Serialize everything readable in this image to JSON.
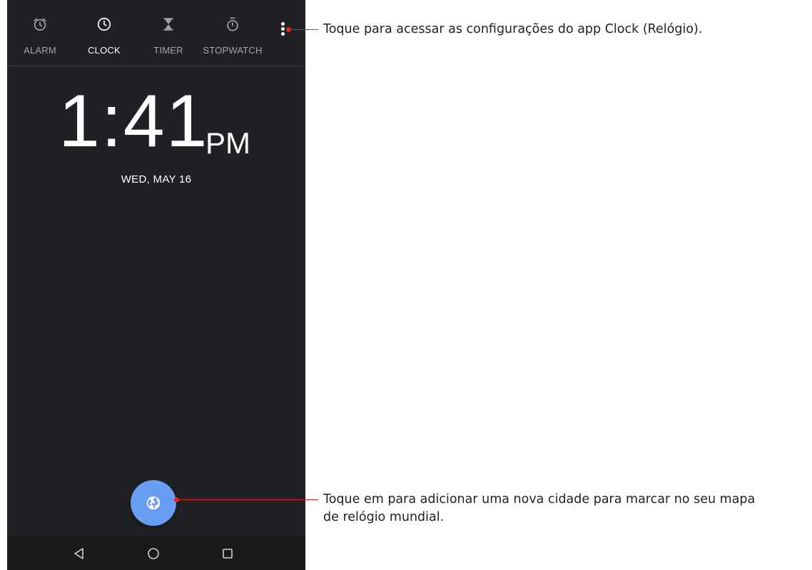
{
  "tabs": [
    {
      "label": "ALARM",
      "icon": "alarm-icon"
    },
    {
      "label": "CLOCK",
      "icon": "clock-icon",
      "active": true
    },
    {
      "label": "TIMER",
      "icon": "hourglass-icon"
    },
    {
      "label": "STOPWATCH",
      "icon": "stopwatch-icon"
    }
  ],
  "overflow_menu": {
    "icon": "more-vert-icon"
  },
  "clock": {
    "time": "1:41",
    "ampm": "PM",
    "date": "WED, MAY 16"
  },
  "fab": {
    "icon": "globe-icon"
  },
  "nav": [
    {
      "icon": "back-icon"
    },
    {
      "icon": "home-icon"
    },
    {
      "icon": "recents-icon"
    }
  ],
  "annotations": {
    "settings": "Toque para acessar as configurações do app Clock (Relógio).",
    "add_city_line1": "Toque em para adicionar uma nova cidade para marcar no seu mapa",
    "add_city_line2": "de relógio mundial."
  },
  "colors": {
    "background": "#202124",
    "fab": "#6a9ef3",
    "callout": "#e2231a",
    "inactive_tab": "#a3a5a8"
  }
}
